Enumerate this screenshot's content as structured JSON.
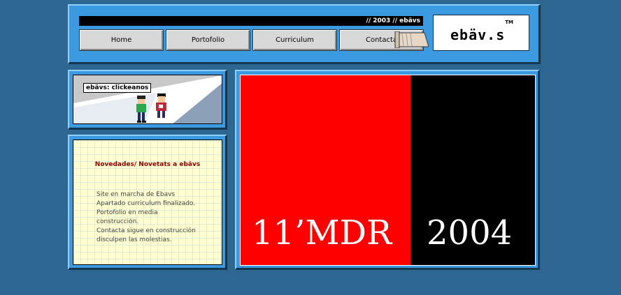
{
  "header": {
    "topbar_text": "// 2003 // ebävs",
    "nav": [
      "Home",
      "Portofolio",
      "Curriculum",
      "Contacta"
    ],
    "logo_text": "ebäv.s",
    "logo_tm": "TM"
  },
  "comic": {
    "label": "ebävs: clickeanos"
  },
  "news": {
    "title": "Novedades/ Novetats a ebävs",
    "lines": [
      "Site en marcha de Ebavs",
      "Apartado curriculum finalizado.",
      "Portofolio en media",
      "construcción.",
      "Contacta sigue en construcción",
      "disculpen las molestias."
    ]
  },
  "poster": {
    "left_text": "11’MDR",
    "right_text": "2004"
  },
  "colors": {
    "background": "#2d6690",
    "panel": "#3c9be0",
    "poster_red": "#ff0000",
    "poster_black": "#000000",
    "news_bg": "#ffffd2",
    "news_title": "#8b0000"
  }
}
